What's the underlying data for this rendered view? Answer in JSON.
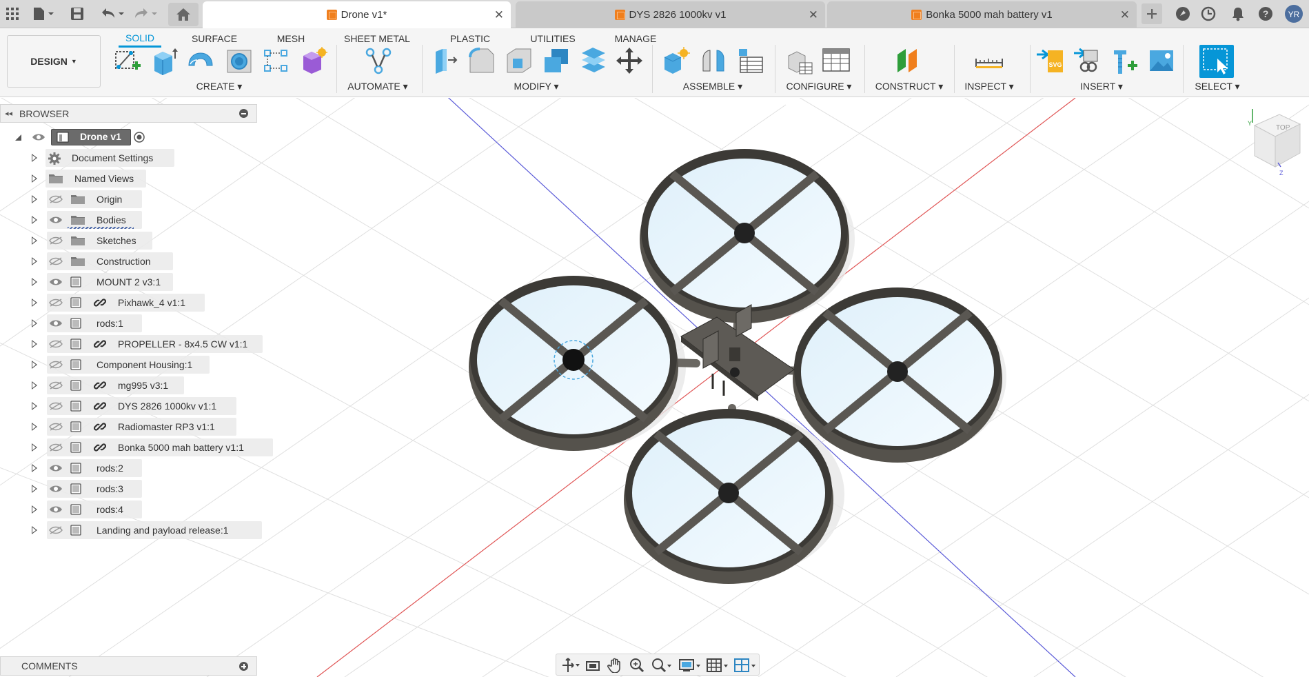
{
  "window": {
    "tabs": [
      {
        "label": "Drone v1*",
        "active": true
      },
      {
        "label": "DYS 2826 1000kv v1",
        "active": false
      },
      {
        "label": "Bonka 5000 mah battery v1",
        "active": false
      }
    ],
    "left_icons": [
      "app-grid-icon",
      "file-icon",
      "save-icon",
      "undo-icon",
      "redo-icon",
      "home-icon"
    ],
    "right_icons": [
      "new-tab-plus-icon",
      "extensions-icon",
      "job-status-clock-icon",
      "notifications-bell-icon",
      "help-icon"
    ]
  },
  "toolbar": {
    "workspace_button": "DESIGN",
    "workspace_tabs": [
      "SOLID",
      "SURFACE",
      "MESH",
      "SHEET METAL",
      "PLASTIC",
      "UTILITIES",
      "MANAGE"
    ],
    "active_workspace_tab": "SOLID",
    "groups": [
      {
        "label": "CREATE",
        "tools": [
          "create-sketch-icon",
          "extrude-icon",
          "revolve-icon",
          "hole-icon",
          "pattern-icon",
          "form-icon"
        ]
      },
      {
        "label": "AUTOMATE",
        "tools": [
          "automate-icon"
        ]
      },
      {
        "label": "MODIFY",
        "tools": [
          "press-pull-icon",
          "fillet-icon",
          "shell-icon",
          "combine-icon",
          "offset-face-icon",
          "move-icon"
        ]
      },
      {
        "label": "ASSEMBLE",
        "tools": [
          "new-component-icon",
          "joint-icon",
          "bom-icon"
        ]
      },
      {
        "label": "CONFIGURE",
        "tools": [
          "configure-icon",
          "configuration-table-icon"
        ]
      },
      {
        "label": "CONSTRUCT",
        "tools": [
          "offset-plane-icon"
        ]
      },
      {
        "label": "INSPECT",
        "tools": [
          "measure-icon"
        ]
      },
      {
        "label": "INSERT",
        "tools": [
          "insert-svg-icon",
          "insert-derive-icon",
          "insert-mcmaster-icon",
          "insert-canvas-icon"
        ]
      },
      {
        "label": "SELECT",
        "tools": [
          "select-icon"
        ]
      }
    ]
  },
  "browser": {
    "title": "BROWSER",
    "root": "Drone v1",
    "items": [
      {
        "label": "Document Settings",
        "kind": "settings",
        "eye": "none",
        "link": false
      },
      {
        "label": "Named Views",
        "kind": "folder",
        "eye": "none",
        "link": false
      },
      {
        "label": "Origin",
        "kind": "folder",
        "eye": "hidden",
        "link": false
      },
      {
        "label": "Bodies",
        "kind": "folder",
        "eye": "visible",
        "link": false
      },
      {
        "label": "Sketches",
        "kind": "folder",
        "eye": "hidden",
        "link": false
      },
      {
        "label": "Construction",
        "kind": "folder",
        "eye": "hidden",
        "link": false
      },
      {
        "label": "MOUNT 2 v3:1",
        "kind": "component",
        "eye": "visible",
        "link": false
      },
      {
        "label": "Pixhawk_4 v1:1",
        "kind": "component",
        "eye": "hidden",
        "link": true
      },
      {
        "label": "rods:1",
        "kind": "component",
        "eye": "visible",
        "link": false
      },
      {
        "label": "PROPELLER - 8x4.5 CW v1:1",
        "kind": "component",
        "eye": "hidden",
        "link": true
      },
      {
        "label": "Component Housing:1",
        "kind": "component",
        "eye": "hidden",
        "link": false
      },
      {
        "label": "mg995 v3:1",
        "kind": "component",
        "eye": "hidden",
        "link": true
      },
      {
        "label": "DYS 2826 1000kv v1:1",
        "kind": "component",
        "eye": "hidden",
        "link": true
      },
      {
        "label": "Radiomaster RP3 v1:1",
        "kind": "component",
        "eye": "hidden",
        "link": true
      },
      {
        "label": "Bonka 5000 mah battery v1:1",
        "kind": "component",
        "eye": "hidden",
        "link": true
      },
      {
        "label": "rods:2",
        "kind": "component",
        "eye": "visible",
        "link": false
      },
      {
        "label": "rods:3",
        "kind": "component",
        "eye": "visible",
        "link": false
      },
      {
        "label": "rods:4",
        "kind": "component",
        "eye": "visible",
        "link": false
      },
      {
        "label": "Landing and payload release:1",
        "kind": "component",
        "eye": "hidden",
        "link": false
      }
    ]
  },
  "comments": {
    "title": "COMMENTS"
  },
  "viewcube": {
    "face_label": "TOP",
    "axis_labels": [
      "Y",
      "Z"
    ]
  },
  "navbar": {
    "icons": [
      "orbit-icon",
      "look-at-icon",
      "pan-icon",
      "zoom-icon",
      "zoom-window-icon",
      "display-settings-icon",
      "grid-settings-icon",
      "viewports-icon"
    ]
  },
  "colors": {
    "accent": "#0696d7",
    "origin_red": "#e05555",
    "origin_blue": "#5a5ad8",
    "frame_dark": "#55524c"
  }
}
